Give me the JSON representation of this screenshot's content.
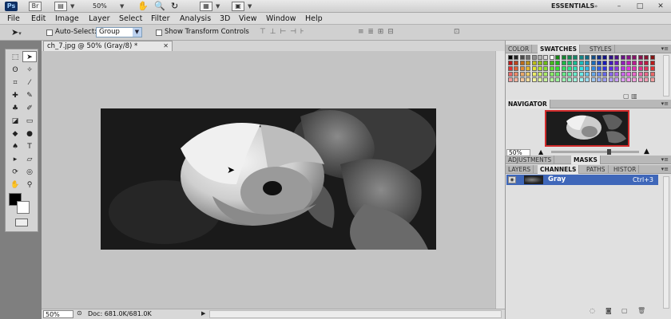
{
  "app": {
    "logo": "Ps",
    "zoom": "50%",
    "workspace": "ESSENTIALS"
  },
  "menu": [
    "File",
    "Edit",
    "Image",
    "Layer",
    "Select",
    "Filter",
    "Analysis",
    "3D",
    "View",
    "Window",
    "Help"
  ],
  "options": {
    "auto_select_label": "Auto-Select:",
    "auto_select_value": "Group",
    "show_transform_label": "Show Transform Controls"
  },
  "document": {
    "tab_title": "ch_7.jpg @ 50% (Gray/8) *",
    "zoom": "50%",
    "doc_size": "Doc: 681.0K/681.0K"
  },
  "panels": {
    "top_tabs": [
      "COLOR",
      "SWATCHES",
      "STYLES"
    ],
    "navigator_tab": "NAVIGATOR",
    "navigator_zoom": "50%",
    "mid_tabs": [
      "ADJUSTMENTS",
      "MASKS"
    ],
    "bottom_tabs": [
      "LAYERS",
      "CHANNELS",
      "PATHS",
      "HISTOR"
    ],
    "channel": {
      "name": "Gray",
      "shortcut": "Ctrl+3"
    }
  },
  "colors": {
    "accent": "#3f67b9",
    "nav_frame": "#d12b2b"
  }
}
